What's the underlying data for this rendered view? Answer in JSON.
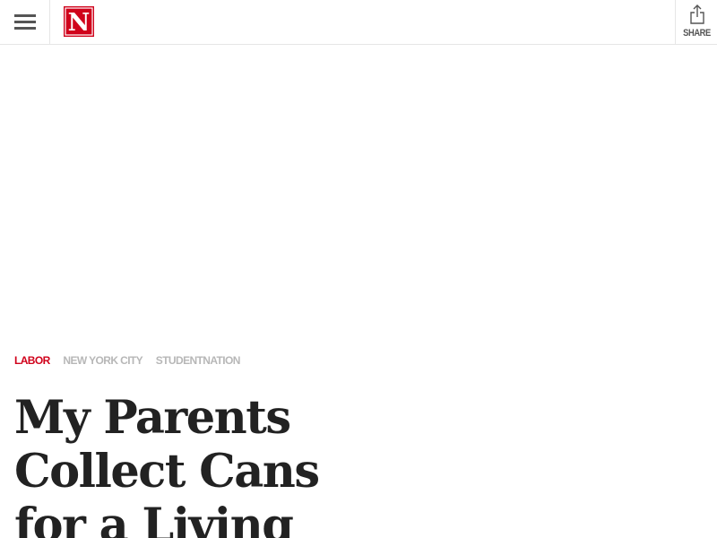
{
  "header": {
    "menu_icon": "hamburger-menu-icon",
    "logo_letter": "N",
    "share_label": "SHARE",
    "share_icon": "share-upload-icon",
    "brand_color": "#d0021b"
  },
  "article": {
    "tags": [
      {
        "label": "LABOR",
        "color": "#d0021b"
      },
      {
        "label": "NEW YORK CITY",
        "color": "#b7b7b7"
      },
      {
        "label": "STUDENTNATION",
        "color": "#b7b7b7"
      }
    ],
    "headline": "My Parents Collect Cans for a Living"
  }
}
